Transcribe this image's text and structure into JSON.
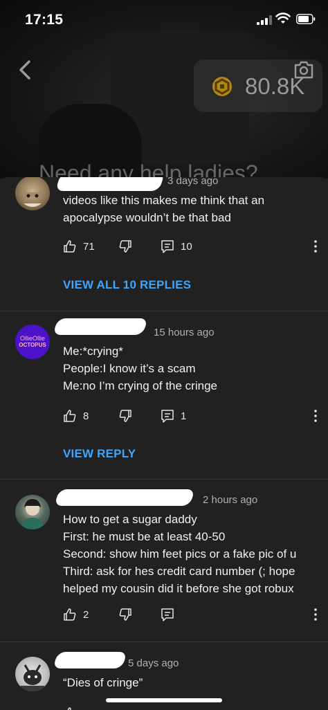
{
  "status_bar": {
    "time": "17:15"
  },
  "header": {
    "coins": "80.8K",
    "video_caption": "Need any help ladies?"
  },
  "comments": [
    {
      "time": "3 days ago",
      "lines": [
        "videos like this makes me think that an",
        "apocalypse wouldn’t be that bad"
      ],
      "likes": "71",
      "replies": "10",
      "reply_link": "VIEW ALL 10 REPLIES"
    },
    {
      "time": "15 hours ago",
      "avatar_text": [
        "OllieOllie",
        "OCTOPUS"
      ],
      "lines": [
        "Me:*crying*",
        "People:I know it’s a scam",
        "Me:no I’m crying of the cringe"
      ],
      "likes": "8",
      "replies": "1",
      "reply_link": "VIEW REPLY"
    },
    {
      "time": "2 hours ago",
      "lines": [
        "How to get a sugar daddy",
        "First: he must be at least 40-50",
        "Second: show him feet pics or a fake pic of u",
        "Third: ask for hes credit card number (; hope",
        "helped my cousin did it before she got robux"
      ],
      "likes": "2",
      "replies": ""
    },
    {
      "time": "5 days ago",
      "lines": [
        "“Dies of cringe”"
      ]
    }
  ],
  "colors": {
    "background": "#212121",
    "link": "#3ea6ff",
    "meta_text": "#b0b0b0"
  }
}
